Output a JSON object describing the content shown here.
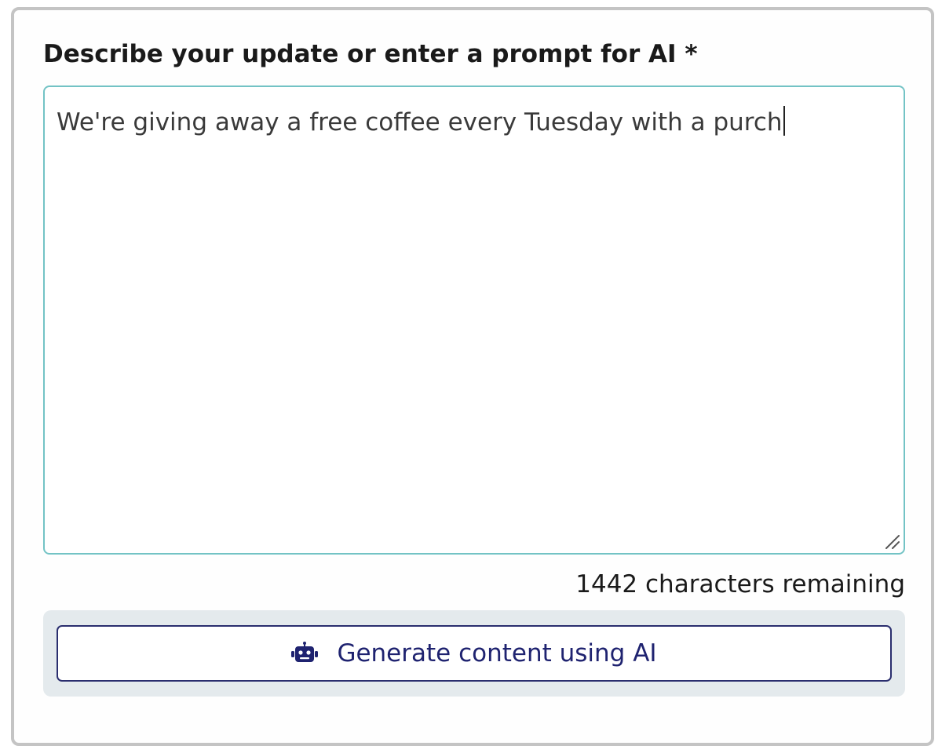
{
  "form": {
    "label": "Describe your update or enter a prompt for AI *",
    "textarea_value": "We're giving away a free coffee every Tuesday with a purch",
    "chars_remaining": "1442 characters remaining",
    "generate_button_label": "Generate content using AI",
    "generate_button_icon": "robot-icon"
  },
  "colors": {
    "textarea_border": "#73c3c5",
    "button_border": "#2a2e6e",
    "button_text": "#1f2370",
    "panel_background": "#e4eaed"
  }
}
